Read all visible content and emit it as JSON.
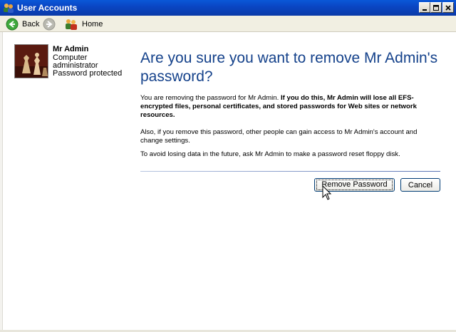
{
  "window": {
    "title": "User Accounts"
  },
  "toolbar": {
    "back_label": "Back",
    "home_label": "Home"
  },
  "user": {
    "name": "Mr Admin",
    "role_line1": "Computer",
    "role_line2": "administrator",
    "status": "Password protected"
  },
  "main": {
    "heading": "Are you sure you want to remove Mr Admin's password?",
    "p1_normal": "You are removing the password for Mr Admin. ",
    "p1_bold": "If you do this, Mr Admin will lose all EFS-encrypted files, personal certificates, and stored passwords for Web sites or network resources.",
    "p2": "Also, if you remove this password, other people can gain access to Mr Admin's account and change settings.",
    "p3": "To avoid losing data in the future, ask Mr Admin to make a password reset floppy disk."
  },
  "buttons": {
    "remove_label": "Remove Password",
    "cancel_label": "Cancel"
  },
  "colors": {
    "title_bar": "#0a46c4",
    "heading": "#15428b"
  }
}
